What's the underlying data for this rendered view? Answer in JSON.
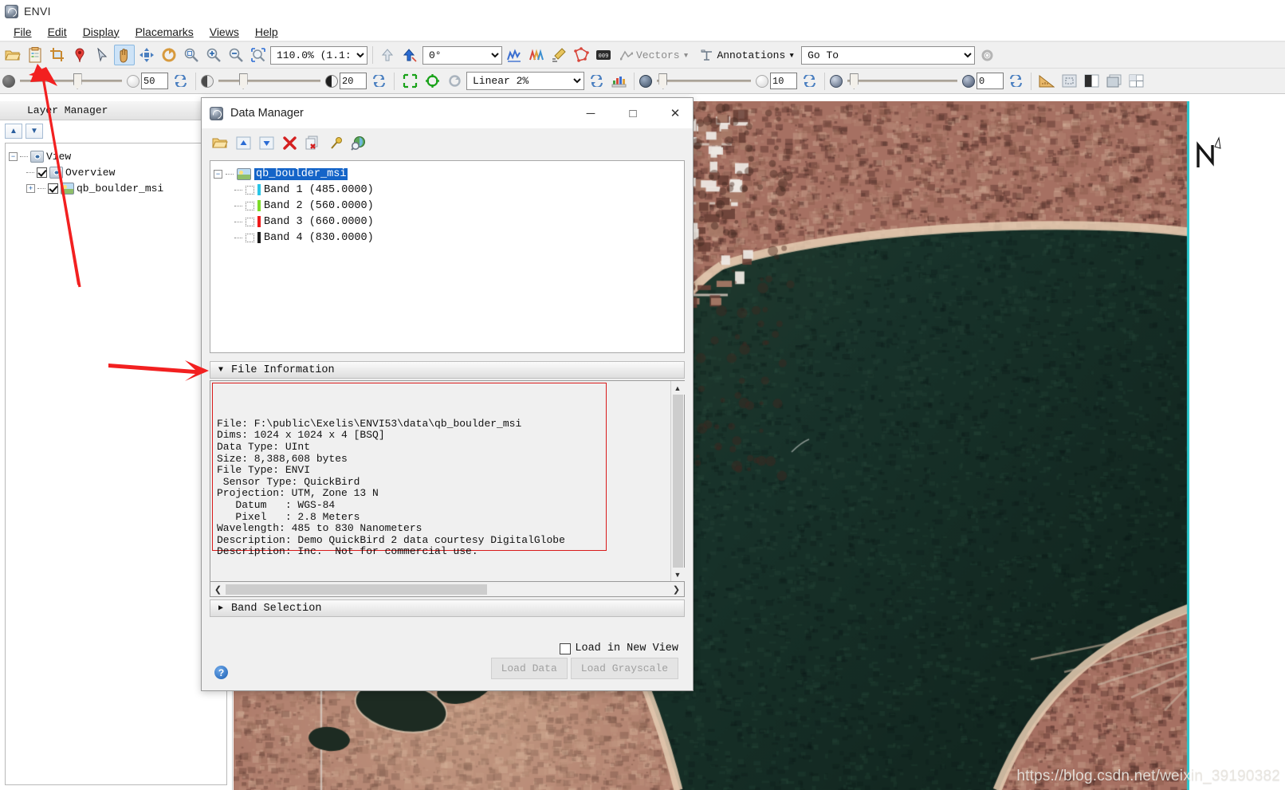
{
  "app": {
    "title": "ENVI",
    "icon": "envi-logo-icon"
  },
  "menubar": {
    "items": [
      {
        "label": "File"
      },
      {
        "label": "Edit"
      },
      {
        "label": "Display"
      },
      {
        "label": "Placemarks"
      },
      {
        "label": "Views"
      },
      {
        "label": "Help"
      }
    ]
  },
  "toolbar_row1": {
    "buttons": [
      {
        "name": "open-file-icon",
        "glyph": "📂"
      },
      {
        "name": "data-manager-icon",
        "glyph": "📋"
      },
      {
        "name": "crop-icon",
        "glyph": "⌗"
      },
      {
        "name": "placemark-pin-icon",
        "glyph": "📍"
      },
      {
        "name": "select-arrow-icon",
        "glyph": "➤"
      },
      {
        "name": "pan-hand-icon",
        "glyph": "✋"
      },
      {
        "name": "fly-icon",
        "glyph": "✥"
      },
      {
        "name": "rotate-icon",
        "glyph": "↻"
      },
      {
        "name": "zoom-to-fit-icon",
        "glyph": "🔍"
      },
      {
        "name": "zoom-in-icon",
        "glyph": "🔍"
      },
      {
        "name": "zoom-out-icon",
        "glyph": "🔍"
      },
      {
        "name": "zoom-to-selection-icon",
        "glyph": "🔍"
      }
    ],
    "zoom_value": "110.0% (1.1::",
    "go_up_icon": "go-up-level-icon",
    "go_geo_icon": "geo-link-icon",
    "rotation_value": "0°",
    "after_buttons": [
      {
        "name": "spectral-profile-icon",
        "glyph": "⌇"
      },
      {
        "name": "multi-spectral-profile-icon",
        "glyph": "⌇"
      },
      {
        "name": "pixel-editor-icon",
        "glyph": "✎"
      },
      {
        "name": "region-of-interest-icon",
        "glyph": "◳"
      },
      {
        "name": "cursor-value-icon",
        "glyph": "⌸"
      }
    ],
    "vectors_label": "Vectors",
    "annotations_label": "Annotations",
    "goto_value": "Go To",
    "preferences_icon": "gear-preferences-icon"
  },
  "toolbar_row2": {
    "brightness_value": "50",
    "contrast_value": "20",
    "sharpen_value": "10",
    "transparency_value": "0",
    "stretch_value": "Linear 2%",
    "reset_icon": "reset-icon",
    "buttons": [
      {
        "name": "stretch-on-view-icon",
        "glyph": "⬚"
      },
      {
        "name": "stretch-on-data-icon",
        "glyph": "⬡"
      },
      {
        "name": "refresh-stretch-icon",
        "glyph": "↻"
      },
      {
        "name": "histogram-icon",
        "glyph": "📊"
      },
      {
        "name": "measure-tool-icon",
        "glyph": "📐"
      },
      {
        "name": "portal-icon",
        "glyph": "▣"
      },
      {
        "name": "blend-icon",
        "glyph": "◧"
      },
      {
        "name": "flicker-icon",
        "glyph": "▧"
      },
      {
        "name": "swipe-icon",
        "glyph": "⊞"
      }
    ]
  },
  "layer_manager": {
    "title": "Layer Manager",
    "move_up_label": "▲",
    "move_down_label": "▼",
    "tree": [
      {
        "label": "View",
        "level": 0,
        "expander": "−",
        "checkbox": null,
        "icon": "view-eye-icon"
      },
      {
        "label": "Overview",
        "level": 1,
        "expander": null,
        "checkbox": "checked",
        "icon": "view-eye-icon"
      },
      {
        "label": "qb_boulder_msi",
        "level": 1,
        "expander": "+",
        "checkbox": "checked",
        "icon": "raster-layer-icon"
      }
    ]
  },
  "image_view": {
    "north_arrow_label": "N",
    "watermark": "https://blog.csdn.net/weixin_39190382"
  },
  "data_manager": {
    "title": "Data Manager",
    "window_buttons": {
      "minimize": "─",
      "maximize": "□",
      "close": "✕"
    },
    "toolbar": [
      {
        "name": "open-file-icon",
        "glyph": "📂"
      },
      {
        "name": "move-up-icon",
        "glyph": "▲"
      },
      {
        "name": "move-down-icon",
        "glyph": "▼"
      },
      {
        "name": "close-file-icon",
        "glyph": "✖"
      },
      {
        "name": "close-all-files-icon",
        "glyph": "✖"
      },
      {
        "name": "pin-icon",
        "glyph": "📌"
      },
      {
        "name": "view-metadata-icon",
        "glyph": "🔎"
      }
    ],
    "tree": {
      "root": {
        "label": "qb_boulder_msi",
        "selected": true,
        "expander": "−"
      },
      "bands": [
        {
          "label": "Band 1  (485.0000)",
          "color": "#29c5e6"
        },
        {
          "label": "Band 2  (560.0000)",
          "color": "#7ddc28"
        },
        {
          "label": "Band 3  (660.0000)",
          "color": "#ee1b1b"
        },
        {
          "label": "Band 4  (830.0000)",
          "color": "#1a1a1a"
        }
      ]
    },
    "file_information": {
      "header": "File Information",
      "expanded_marker": "▼",
      "text": "File: F:\\public\\Exelis\\ENVI53\\data\\qb_boulder_msi\nDims: 1024 x 1024 x 4 [BSQ]\nData Type: UInt\nSize: 8,388,608 bytes\nFile Type: ENVI\n Sensor Type: QuickBird\nProjection: UTM, Zone 13 N\n   Datum   : WGS-84\n   Pixel   : 2.8 Meters\nWavelength: 485 to 830 Nanometers\nDescription: Demo QuickBird 2 data courtesy DigitalGlobe\nDescription: Inc.  Not for commercial use."
    },
    "band_selection": {
      "header": "Band Selection",
      "collapsed_marker": "▶"
    },
    "load_in_new_view_label": "Load in New View",
    "load_data_label": "Load Data",
    "load_grayscale_label": "Load Grayscale",
    "help_label": "?"
  },
  "colors": {
    "accent_blue": "#1464c8",
    "annotation_red": "#ee2222",
    "toolbar_bg": "#f0f0f0",
    "band1": "#29c5e6",
    "band2": "#7ddc28",
    "band3": "#ee1b1b",
    "band4": "#1a1a1a"
  }
}
